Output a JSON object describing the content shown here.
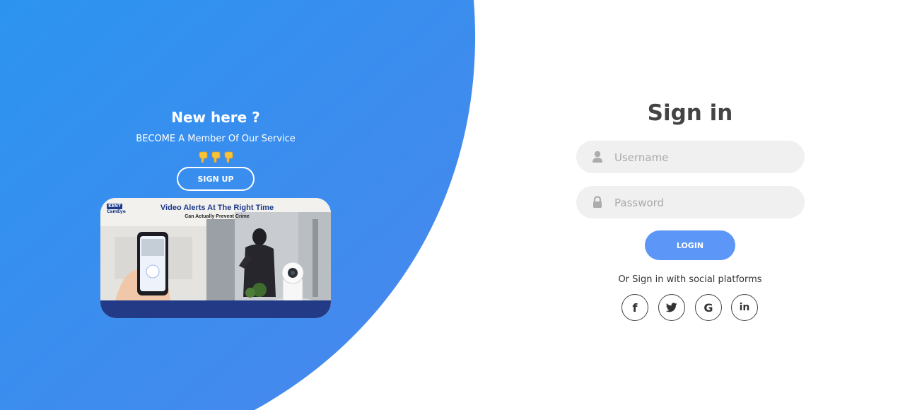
{
  "colors": {
    "primary_gradient_start": "#2f8ff0",
    "primary_gradient_end": "#4a8fef",
    "login_button": "#5c96f6",
    "field_background": "#f0f0f0",
    "title_text": "#444444"
  },
  "left_panel": {
    "title": "New here ?",
    "subtitle": "BECOME A Member Of Our Service",
    "pointer_icons": [
      "pointing-down-hand-icon",
      "pointing-down-hand-icon",
      "pointing-down-hand-icon"
    ],
    "signup_label": "SIGN UP"
  },
  "ad_banner": {
    "brand_kent": "KENT",
    "brand_product": "CamEye",
    "headline": "Video Alerts At The Right Time",
    "subline": "Can Actually Prevent Crime"
  },
  "signin_form": {
    "title": "Sign in",
    "username": {
      "placeholder": "Username",
      "value": "",
      "icon": "user-icon"
    },
    "password": {
      "placeholder": "Password",
      "value": "",
      "icon": "lock-icon"
    },
    "login_label": "LOGIN",
    "social_text": "Or Sign in with social platforms",
    "social": {
      "facebook": {
        "icon": "facebook-icon",
        "glyph": "f"
      },
      "twitter": {
        "icon": "twitter-icon"
      },
      "google": {
        "icon": "google-icon",
        "glyph": "G"
      },
      "linkedin": {
        "icon": "linkedin-icon",
        "glyph": "in"
      }
    }
  }
}
